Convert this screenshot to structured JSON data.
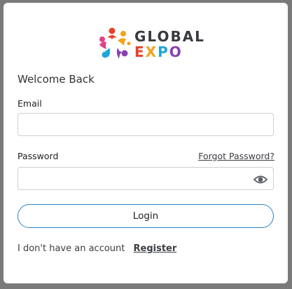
{
  "logo": {
    "line1": "GLOBAL",
    "line2": [
      "E",
      "X",
      "P",
      "O"
    ],
    "line2_colors": [
      "#e8412a",
      "#f2a21c",
      "#20a6de",
      "#8a3fb0"
    ],
    "icon": "people-circle-logo-icon"
  },
  "form": {
    "heading": "Welcome Back",
    "email_label": "Email",
    "email_value": "",
    "email_placeholder": "",
    "password_label": "Password",
    "password_value": "",
    "password_placeholder": "",
    "forgot_link": "Forgot Password?",
    "password_toggle_icon": "eye-icon",
    "login_button": "Login"
  },
  "footer": {
    "prompt": "I don't have an account",
    "register_link": "Register"
  },
  "colors": {
    "accent": "#2c82c4",
    "backdrop": "#7a7a7a"
  }
}
